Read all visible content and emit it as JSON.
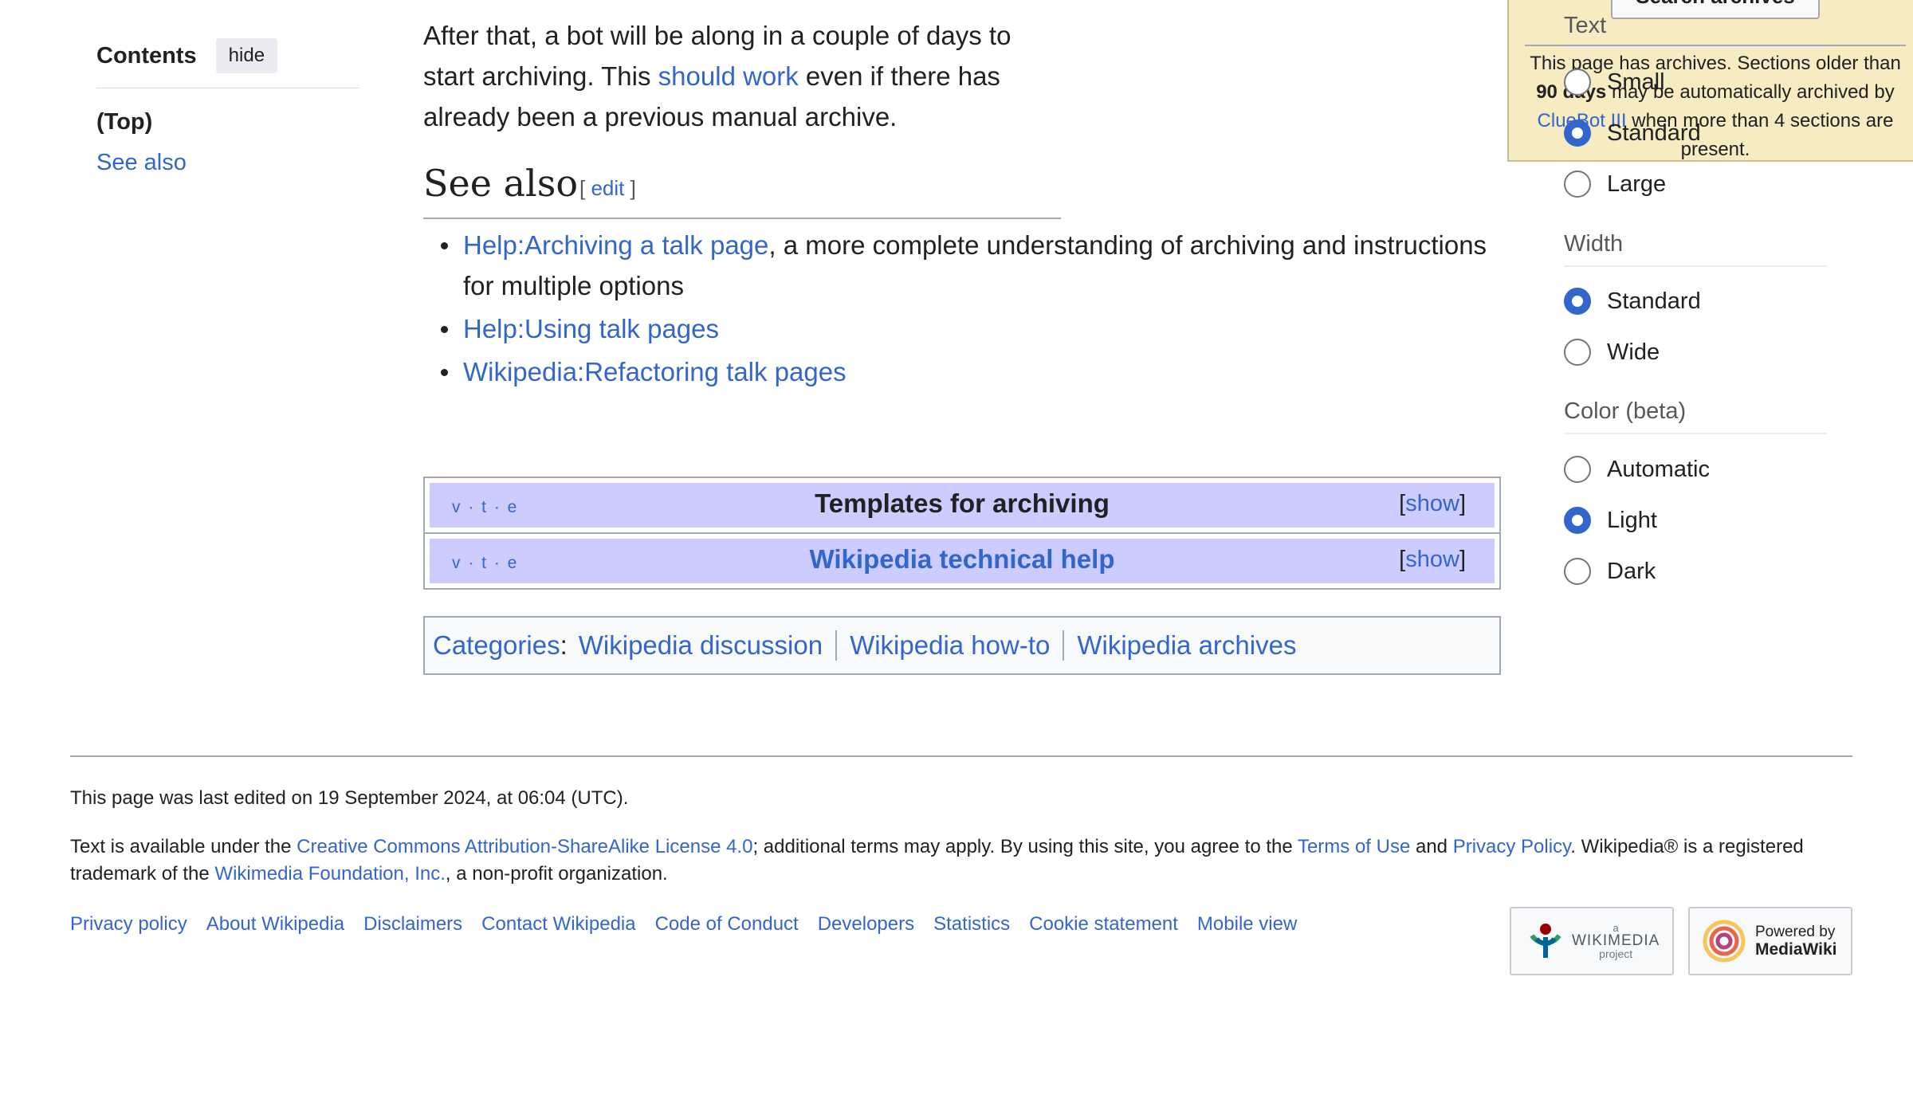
{
  "toc": {
    "title": "Contents",
    "hide_label": "hide",
    "items": [
      "(Top)",
      "See also"
    ]
  },
  "intro": {
    "text_before": "After that, a bot will be along in a couple of days to start archiving. This ",
    "link": "should work",
    "text_after": " even if there has already been a previous manual archive."
  },
  "archive_box": {
    "search_button": "Search archives",
    "text_1": "This page has archives. Sections older than ",
    "bold": "90 days",
    "text_2": " may be automatically archived by ",
    "link": "ClueBot III",
    "text_3": " when more than 4 sections are present."
  },
  "see_also": {
    "heading": "See also",
    "edit_open": "[ ",
    "edit_label": "edit",
    "edit_close": " ]",
    "items": [
      {
        "link": "Help:Archiving a talk page",
        "text": ", a more complete understanding of archiving and instructions for multiple options"
      },
      {
        "link": "Help:Using talk pages",
        "text": ""
      },
      {
        "link": "Wikipedia:Refactoring talk pages",
        "text": ""
      }
    ]
  },
  "navboxes": [
    {
      "vte": "v · t · e",
      "title": "Templates for archiving",
      "show_open": "[",
      "show": "show",
      "show_close": "]"
    },
    {
      "vte": "v · t · e",
      "title": "Wikipedia technical help",
      "show_open": "[",
      "show": "show",
      "show_close": "]"
    }
  ],
  "categories": {
    "label": "Categories",
    "colon": ":",
    "items": [
      "Wikipedia discussion",
      "Wikipedia how-to",
      "Wikipedia archives"
    ]
  },
  "footer": {
    "last_edited": "This page was last edited on 19 September 2024, at 06:04 (UTC).",
    "license_1": "Text is available under the ",
    "license_link": "Creative Commons Attribution-ShareAlike License 4.0",
    "license_2": "; additional terms may apply. By using this site, you agree to the ",
    "terms_link": "Terms of Use",
    "license_3": " and ",
    "privacy_link": "Privacy Policy",
    "license_4": ". Wikipedia® is a registered trademark of the ",
    "wmf_link": "Wikimedia Foundation, Inc.",
    "license_5": ", a non-profit organization.",
    "links": [
      "Privacy policy",
      "About Wikipedia",
      "Disclaimers",
      "Contact Wikipedia",
      "Code of Conduct",
      "Developers",
      "Statistics",
      "Cookie statement",
      "Mobile view"
    ],
    "wikimedia_badge": {
      "small": "a",
      "big": "WIKIMEDIA",
      "sub": "project"
    },
    "mediawiki_badge": {
      "line1": "Powered by",
      "line2": "MediaWiki"
    }
  },
  "appearance": {
    "text": {
      "heading": "Text",
      "options": [
        "Small",
        "Standard",
        "Large"
      ],
      "selected": "Standard"
    },
    "width": {
      "heading": "Width",
      "options": [
        "Standard",
        "Wide"
      ],
      "selected": "Standard"
    },
    "color": {
      "heading": "Color (beta)",
      "options": [
        "Automatic",
        "Light",
        "Dark"
      ],
      "selected": "Light"
    }
  },
  "colors": {
    "link": "#3366cc",
    "navbox_title_bg": "#ccccff",
    "archive_bg": "#f7ebc1",
    "radio_selected": "#3366cc"
  }
}
